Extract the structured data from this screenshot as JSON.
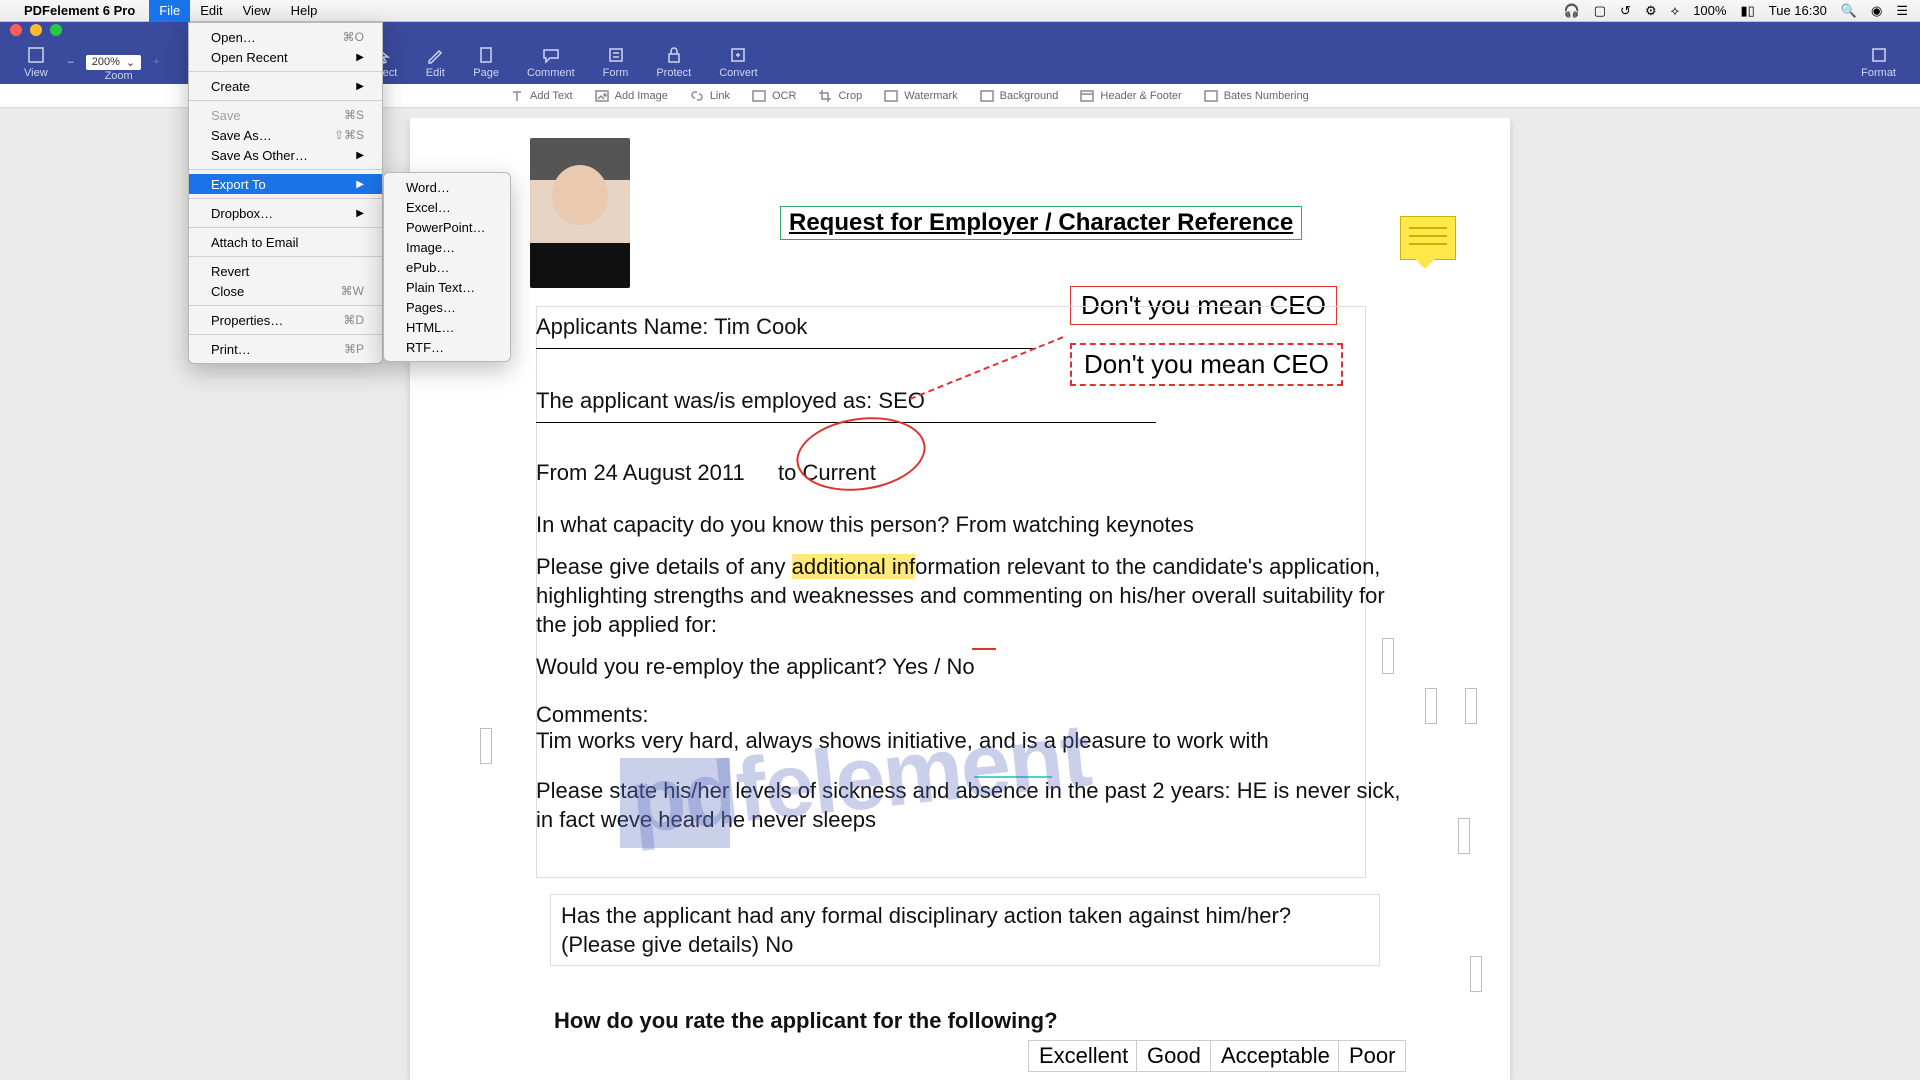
{
  "menubar": {
    "app_name": "PDFelement 6 Pro",
    "items": [
      "File",
      "Edit",
      "View",
      "Help"
    ],
    "status": {
      "battery": "100%",
      "time": "Tue 16:30"
    }
  },
  "file_menu": {
    "open": "Open…",
    "open_sc": "⌘O",
    "open_recent": "Open Recent",
    "create": "Create",
    "save": "Save",
    "save_sc": "⌘S",
    "save_as": "Save As…",
    "save_as_sc": "⇧⌘S",
    "save_other": "Save As Other…",
    "export_to": "Export To",
    "dropbox": "Dropbox…",
    "attach": "Attach to Email",
    "revert": "Revert",
    "close": "Close",
    "close_sc": "⌘W",
    "properties": "Properties…",
    "properties_sc": "⌘D",
    "print": "Print…",
    "print_sc": "⌘P"
  },
  "export_sub": {
    "word": "Word…",
    "excel": "Excel…",
    "ppt": "PowerPoint…",
    "image": "Image…",
    "epub": "ePub…",
    "plain": "Plain Text…",
    "pages": "Pages…",
    "html": "HTML…",
    "rtf": "RTF…"
  },
  "toolbar": {
    "view": "View",
    "zoom_label": "Zoom",
    "zoom_value": "200%",
    "select": "Select",
    "edit": "Edit",
    "page": "Page",
    "comment": "Comment",
    "form": "Form",
    "protect": "Protect",
    "convert": "Convert",
    "format": "Format"
  },
  "subtoolbar": {
    "add_text": "Add Text",
    "add_image": "Add Image",
    "link": "Link",
    "ocr": "OCR",
    "crop": "Crop",
    "watermark": "Watermark",
    "background": "Background",
    "header_footer": "Header & Footer",
    "bates": "Bates Numbering"
  },
  "doc": {
    "title": "Request for Employer / Character Reference",
    "applicant_label": "Applicants Name: Tim Cook",
    "employed_label": "The applicant was/is employed as: SEO",
    "from_label": "From 24 August 2011",
    "to_label": "to Current",
    "capacity": "In what capacity do you know this person? From watching keynotes",
    "details_1": "Please give details of any ",
    "details_hl": "additional inf",
    "details_2": "ormation relevant to the candidate's application, highlighting strengths and weaknesses and commenting on his/her overall suitability for the job applied for:",
    "reemploy": "Would you re-employ the applicant?    Yes / No",
    "comments_label": "Comments:",
    "comments_text": "Tim works very hard, always shows initiative, and is a pleasure to work with",
    "sickness": "Please state his/her levels of sickness and absence in the past 2 years: HE is never sick, in fact weve heard he never sleeps",
    "disciplinary": "Has the applicant had any formal disciplinary action taken against him/her? (Please give details) No",
    "rate_q": "How do you rate the applicant for the following?",
    "ratings": [
      "Excellent",
      "Good",
      "Acceptable",
      "Poor"
    ],
    "note1": "Don't you mean CEO",
    "note2": "Don't you mean CEO",
    "watermark": "pdfelement"
  }
}
